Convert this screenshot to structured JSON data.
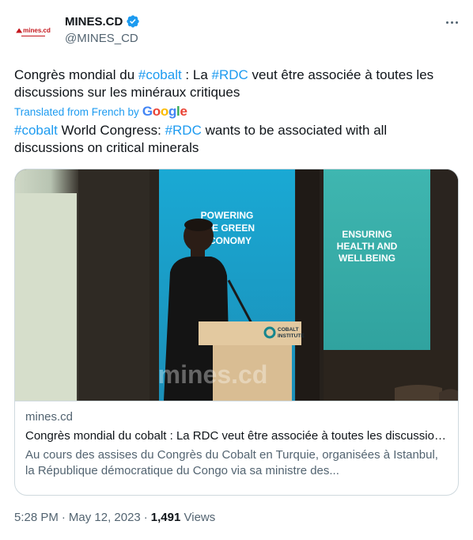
{
  "author": {
    "display_name": "MINES.CD",
    "handle": "@MINES_CD",
    "logo_text": "mines.cd",
    "verified": true,
    "verified_color": "#1d9bf0"
  },
  "tweet": {
    "original_parts": [
      {
        "text": "Congrès mondial du ",
        "tag": false
      },
      {
        "text": "#cobalt",
        "tag": true
      },
      {
        "text": " : La ",
        "tag": false
      },
      {
        "text": "#RDC",
        "tag": true
      },
      {
        "text": " veut être associée à toutes les discussions sur les minéraux critiques",
        "tag": false
      }
    ],
    "translated_label": "Translated from French by",
    "translator_brand": "Google",
    "translation_parts": [
      {
        "text": "#cobalt",
        "tag": true
      },
      {
        "text": " World Congress: ",
        "tag": false
      },
      {
        "text": "#RDC",
        "tag": true
      },
      {
        "text": " wants to be associated with all discussions on critical minerals",
        "tag": false
      }
    ]
  },
  "card": {
    "image": {
      "screen_left_text": "POWERING THE GREEN ECONOMY",
      "screen_right_text": "ENSURING HEALTH AND WELLBEING",
      "podium_text": "COBALT INSTITUTE",
      "watermark": "mines.cd"
    },
    "domain": "mines.cd",
    "title": "Congrès mondial du cobalt : La RDC veut être associée à toutes les discussions sur les minéraux critiques",
    "description": "Au cours des assises du Congrès du Cobalt en Turquie, organisées à Istanbul, la République démocratique du Congo via sa ministre des..."
  },
  "meta": {
    "time": "5:28 PM",
    "separator": "·",
    "date": "May 12, 2023",
    "separator2": "·",
    "views_count": "1,491",
    "views_label": "Views"
  },
  "icons": {
    "verified": "verified-badge-icon",
    "more": "more-options-icon"
  }
}
